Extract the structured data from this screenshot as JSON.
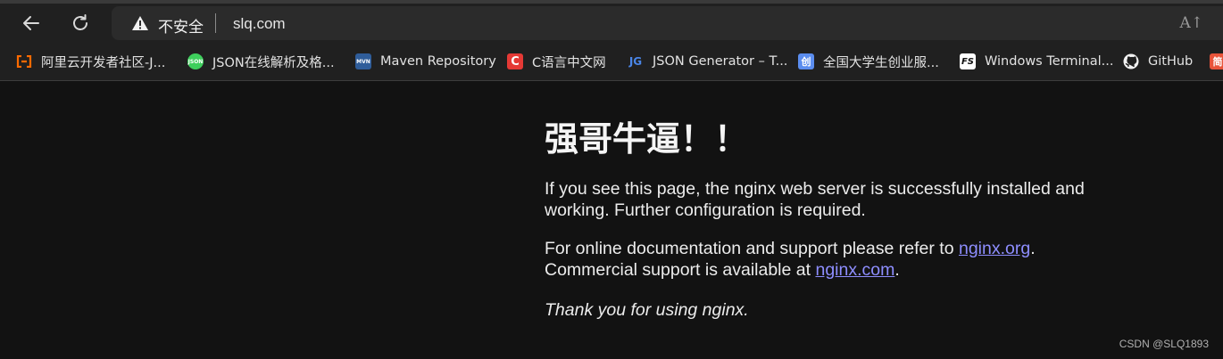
{
  "browser": {
    "security_label": "不安全",
    "url": "slq.com",
    "read_aloud_label": "A↑"
  },
  "bookmarks": [
    {
      "label": "阿里云开发者社区-J...",
      "icon": "aliyun-icon",
      "color": "#ff6a00"
    },
    {
      "label": "JSON在线解析及格...",
      "icon": "json-icon",
      "color": "#3ecf5c"
    },
    {
      "label": "Maven Repository",
      "icon": "maven-icon",
      "color": "#3b6fb6"
    },
    {
      "label": "C语言中文网",
      "icon": "c-icon",
      "color": "#e53935"
    },
    {
      "label": "JSON Generator – T...",
      "icon": "jg-icon",
      "color": "#4a86e8"
    },
    {
      "label": "全国大学生创业服...",
      "icon": "chuang-icon",
      "color": "#5b8def"
    },
    {
      "label": "Windows Terminal...",
      "icon": "fs-icon",
      "color": "#ffffff"
    },
    {
      "label": "GitHub",
      "icon": "github-icon",
      "color": "#ffffff"
    },
    {
      "label": "简",
      "icon": "jian-icon",
      "color": "#e8543a"
    }
  ],
  "page": {
    "heading": "强哥牛逼！！",
    "p1": "If you see this page, the nginx web server is successfully installed and working. Further configuration is required.",
    "p2_prefix": "For online documentation and support please refer to ",
    "p2_link1": "nginx.org",
    "p2_middle": ". Commercial support is available at ",
    "p2_link2": "nginx.com",
    "p2_suffix": ".",
    "p3": "Thank you for using nginx."
  },
  "watermark": "CSDN @SLQ1893"
}
